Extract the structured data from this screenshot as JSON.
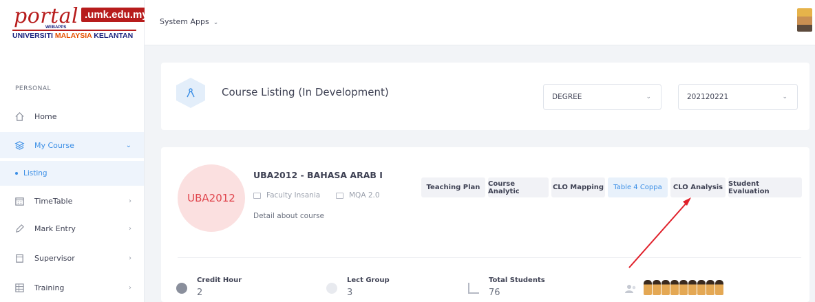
{
  "brand": {
    "portal": "portal",
    "domain": ".umk.edu.my",
    "webapps": "WEBAPPS",
    "uni_part1": "UNIVERSITI ",
    "uni_part2": "MALAYSIA",
    "uni_part3": " KELANTAN"
  },
  "topbar": {
    "system_apps": "System Apps",
    "caret": "⌄"
  },
  "sidebar": {
    "section_label": "PERSONAL",
    "items": [
      {
        "label": "Home",
        "icon": "home-icon"
      },
      {
        "label": "My Course",
        "icon": "layers-icon",
        "active": true
      },
      {
        "label": "TimeTable",
        "icon": "calendar-icon"
      },
      {
        "label": "Mark Entry",
        "icon": "pen-icon"
      },
      {
        "label": "Supervisor",
        "icon": "clipboard-icon"
      },
      {
        "label": "Training",
        "icon": "grid-icon"
      }
    ],
    "sub_item": "Listing",
    "chevron_right": "›",
    "chevron_down": "⌄"
  },
  "header": {
    "title": "Course Listing (In Development)",
    "program_select": "DEGREE",
    "semester_select": "202120221"
  },
  "course": {
    "code": "UBA2012",
    "title": "UBA2012 - BAHASA ARAB I",
    "faculty": "Faculty Insania",
    "mqa": "MQA 2.0",
    "description": "Detail about course",
    "actions": [
      "Teaching Plan",
      "Course Analytic",
      "CLO Mapping",
      "Table 4 Coppa",
      "CLO Analysis",
      "Student Evaluation"
    ],
    "stats": {
      "credit_label": "Credit Hour",
      "credit_value": "2",
      "lect_label": "Lect Group",
      "lect_value": "3",
      "students_label": "Total Students",
      "students_value": "76"
    }
  },
  "colors": {
    "accent": "#3a8ee6",
    "brand_red": "#b71c1c",
    "annotation_arrow": "#e0202a"
  }
}
